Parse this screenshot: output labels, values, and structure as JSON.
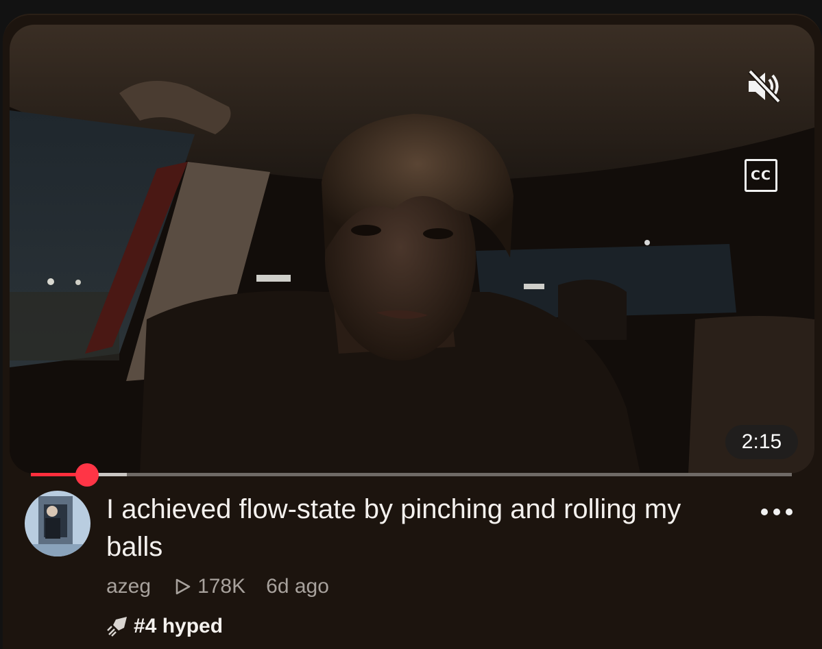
{
  "video": {
    "duration": "2:15",
    "captions_label": "CC",
    "mute_icon": "volume-muted-icon",
    "captions_icon": "closed-captions-icon",
    "progress": {
      "played_fraction": 0.074,
      "buffered_fraction": 0.126
    }
  },
  "details": {
    "title": "I achieved flow-state by pinching and rolling my balls",
    "channel": "azeg",
    "views": "178K",
    "views_icon": "play-outline-icon",
    "age": "6d ago",
    "hype_label": "#4 hyped",
    "hype_icon": "hype-rocket-icon",
    "more_icon": "more-horizontal-icon"
  },
  "colors": {
    "accent_red": "#ff2e3c",
    "card_background": "#1c140e",
    "title_text": "#f4f1ee",
    "meta_text": "#a8a29d"
  }
}
